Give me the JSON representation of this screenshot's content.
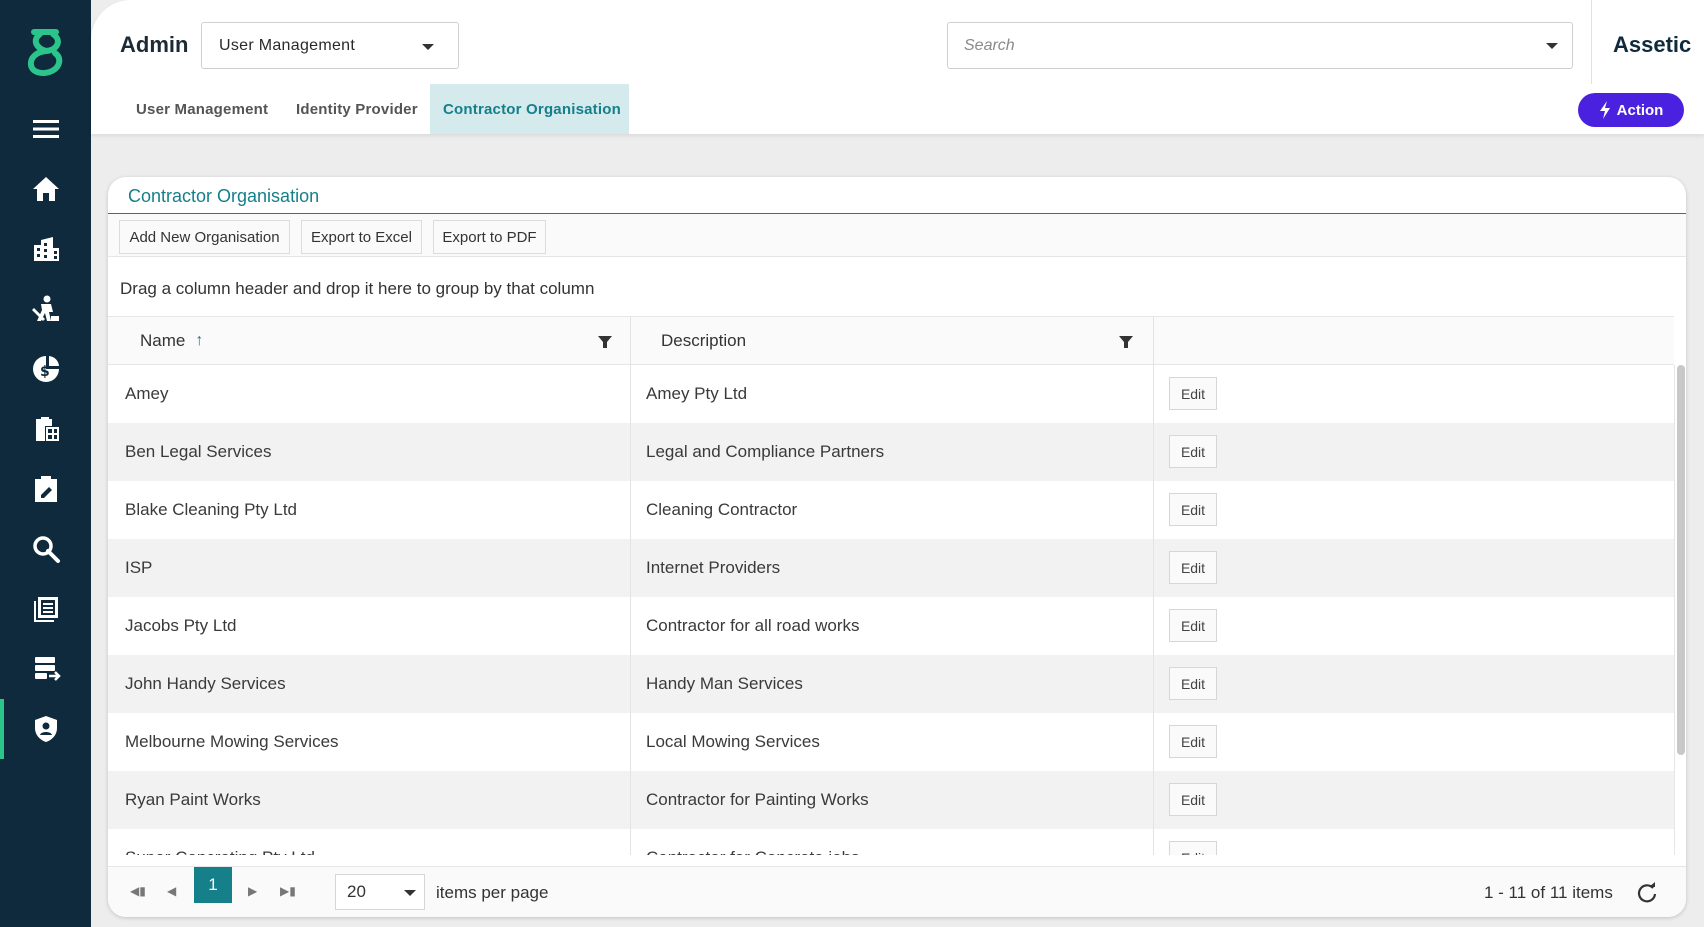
{
  "header": {
    "section_title": "Admin",
    "module_select_value": "User Management",
    "search_placeholder": "Search",
    "brand": "Assetic"
  },
  "sidebar": {
    "items": [
      {
        "icon": "menu-icon"
      },
      {
        "icon": "home-icon"
      },
      {
        "icon": "buildings-icon"
      },
      {
        "icon": "worker-icon"
      },
      {
        "icon": "finance-icon"
      },
      {
        "icon": "clipboard-grid-icon"
      },
      {
        "icon": "clipboard-edit-icon"
      },
      {
        "icon": "search-icon"
      },
      {
        "icon": "documents-icon"
      },
      {
        "icon": "data-transfer-icon"
      },
      {
        "icon": "security-shield-icon",
        "active": true
      }
    ]
  },
  "tabs": [
    {
      "label": "User Management"
    },
    {
      "label": "Identity Provider"
    },
    {
      "label": "Contractor Organisation",
      "active": true
    }
  ],
  "action_button": "Action",
  "panel": {
    "title": "Contractor Organisation",
    "toolbar": {
      "add": "Add New Organisation",
      "excel": "Export to Excel",
      "pdf": "Export to PDF"
    },
    "group_hint": "Drag a column header and drop it here to group by that column",
    "columns": {
      "name": "Name",
      "description": "Description"
    },
    "sort": "ascending",
    "edit_label": "Edit",
    "rows": [
      {
        "name": "Amey",
        "description": "Amey Pty Ltd"
      },
      {
        "name": "Ben Legal Services",
        "description": "Legal and Compliance Partners"
      },
      {
        "name": "Blake Cleaning Pty Ltd",
        "description": "Cleaning Contractor"
      },
      {
        "name": "ISP",
        "description": "Internet Providers"
      },
      {
        "name": "Jacobs Pty Ltd",
        "description": "Contractor for all road works"
      },
      {
        "name": "John Handy Services",
        "description": "Handy Man Services"
      },
      {
        "name": "Melbourne Mowing Services",
        "description": "Local Mowing Services"
      },
      {
        "name": "Ryan Paint Works",
        "description": "Contractor for Painting Works"
      },
      {
        "name": "Super Concreting Pty Ltd",
        "description": "Contractor for Concrete jobs"
      }
    ],
    "pager": {
      "current_page": "1",
      "page_size": "20",
      "per_page_label": "items per page",
      "item_count": "1 - 11 of 11 items"
    }
  },
  "colors": {
    "sidebar": "#0f2a3d",
    "accent": "#157f8a",
    "logo": "#2bc48a",
    "action": "#4b21e0"
  }
}
